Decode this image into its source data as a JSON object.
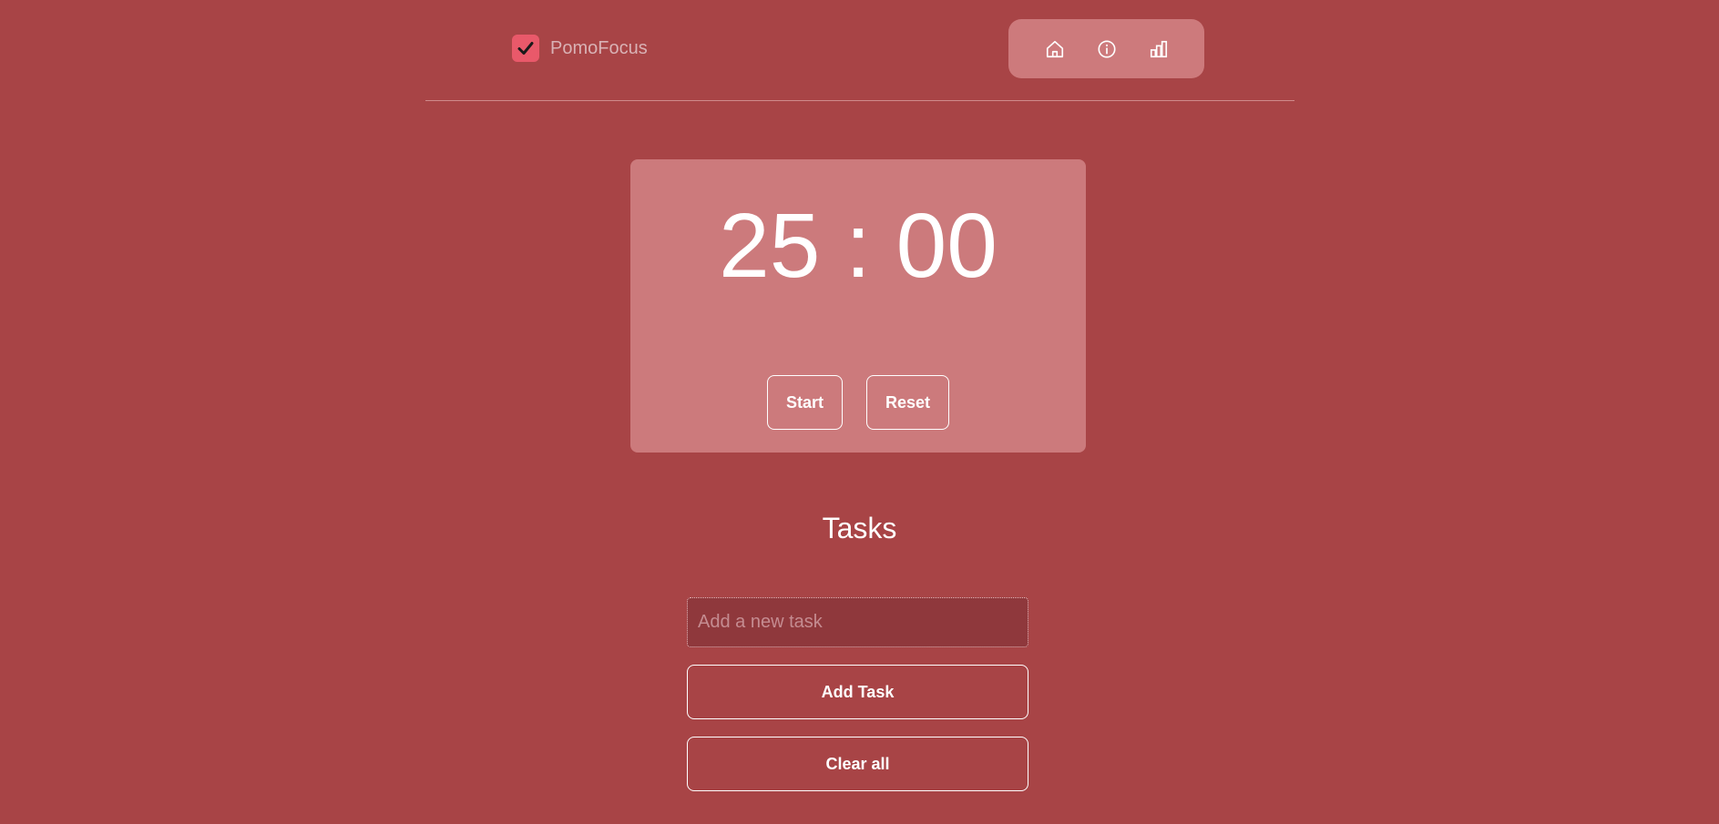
{
  "brand": {
    "name": "PomoFocus",
    "logo_icon": "checkbox-checked-icon",
    "logo_color": "#e9596a"
  },
  "nav": {
    "items": [
      {
        "icon": "home-icon"
      },
      {
        "icon": "info-icon"
      },
      {
        "icon": "bar-chart-icon"
      }
    ]
  },
  "timer": {
    "display": "25 : 00",
    "start_label": "Start",
    "reset_label": "Reset"
  },
  "tasks": {
    "title": "Tasks",
    "input_placeholder": "Add a new task",
    "input_value": "",
    "add_label": "Add Task",
    "clear_label": "Clear all"
  },
  "colors": {
    "background": "#a84446",
    "card": "#cc7a7c",
    "input_background": "#8f383c"
  }
}
